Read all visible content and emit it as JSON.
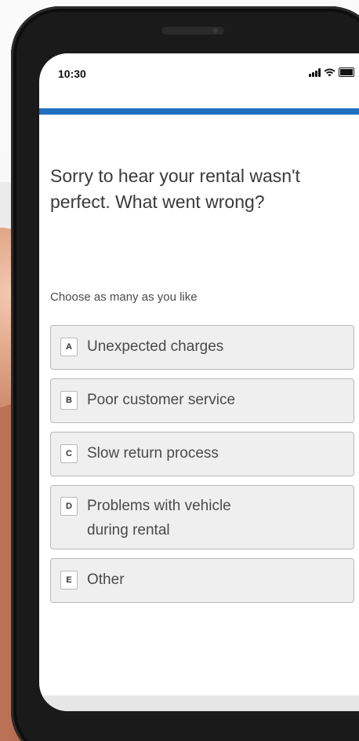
{
  "status_bar": {
    "time": "10:30",
    "icons": [
      "signal-icon",
      "wifi-icon",
      "battery-icon"
    ]
  },
  "survey": {
    "progress_fraction": 1.0,
    "accent_color": "#1f6fbf",
    "question": "Sorry to hear your rental wasn't perfect. What went wrong?",
    "hint": "Choose as many as you like",
    "options": [
      {
        "key": "A",
        "label": "Unexpected charges"
      },
      {
        "key": "B",
        "label": "Poor customer service"
      },
      {
        "key": "C",
        "label": "Slow return process"
      },
      {
        "key": "D",
        "label": "Problems with vehicle during rental"
      },
      {
        "key": "E",
        "label": "Other"
      }
    ]
  }
}
